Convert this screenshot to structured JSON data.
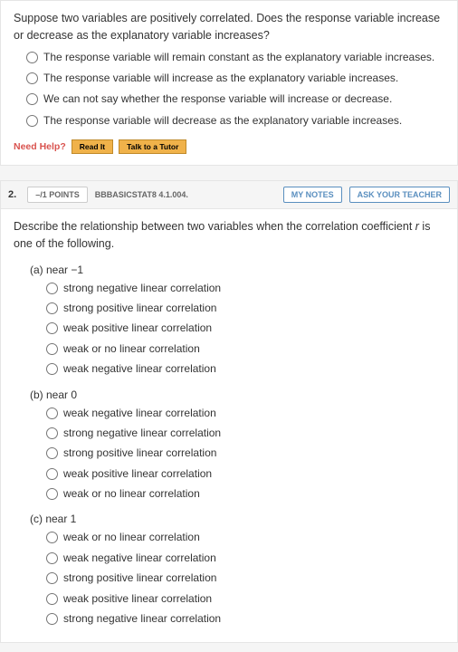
{
  "q1": {
    "prompt": "Suppose two variables are positively correlated. Does the response variable increase or decrease as the explanatory variable increases?",
    "options": [
      "The response variable will remain constant as the explanatory variable increases.",
      "The response variable will increase as the explanatory variable increases.",
      "We can not say whether the response variable will increase or decrease.",
      "The response variable will decrease as the explanatory variable increases."
    ],
    "help": {
      "label": "Need Help?",
      "read": "Read It",
      "tutor": "Talk to a Tutor"
    }
  },
  "q2": {
    "number": "2.",
    "points": "–/1 POINTS",
    "id": "BBBASICSTAT8 4.1.004.",
    "notes_btn": "MY NOTES",
    "ask_btn": "ASK YOUR TEACHER",
    "prompt_pre": "Describe the relationship between two variables when the correlation coefficient ",
    "prompt_var": "r",
    "prompt_post": " is one of the following.",
    "parts": {
      "a": {
        "label": "(a) near −1",
        "options": [
          "strong negative linear correlation",
          "strong positive linear correlation",
          "weak positive linear correlation",
          "weak or no linear correlation",
          "weak negative linear correlation"
        ]
      },
      "b": {
        "label": "(b) near 0",
        "options": [
          "weak negative linear correlation",
          "strong negative linear correlation",
          "strong positive linear correlation",
          "weak positive linear correlation",
          "weak or no linear correlation"
        ]
      },
      "c": {
        "label": "(c) near 1",
        "options": [
          "weak or no linear correlation",
          "weak negative linear correlation",
          "strong positive linear correlation",
          "weak positive linear correlation",
          "strong negative linear correlation"
        ]
      }
    }
  }
}
